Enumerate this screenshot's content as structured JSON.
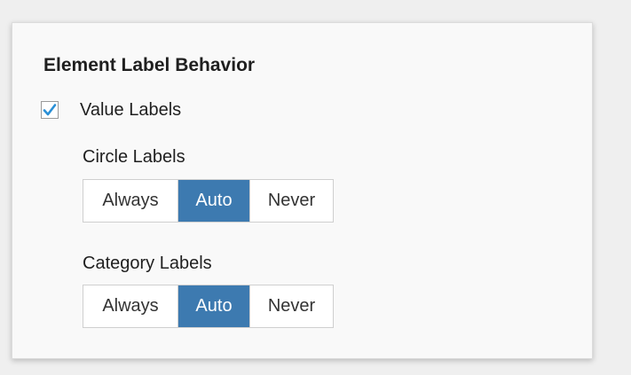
{
  "section": {
    "title": "Element Label Behavior"
  },
  "value_labels": {
    "label": "Value Labels",
    "checked": true
  },
  "circle_labels": {
    "label": "Circle Labels",
    "options": [
      "Always",
      "Auto",
      "Never"
    ],
    "selected": "Auto"
  },
  "category_labels": {
    "label": "Category Labels",
    "options": [
      "Always",
      "Auto",
      "Never"
    ],
    "selected": "Auto"
  },
  "colors": {
    "accent": "#3d7ab0",
    "checkmark": "#2a8fd6"
  },
  "icons": {
    "checkbox": "checkmark-icon"
  }
}
